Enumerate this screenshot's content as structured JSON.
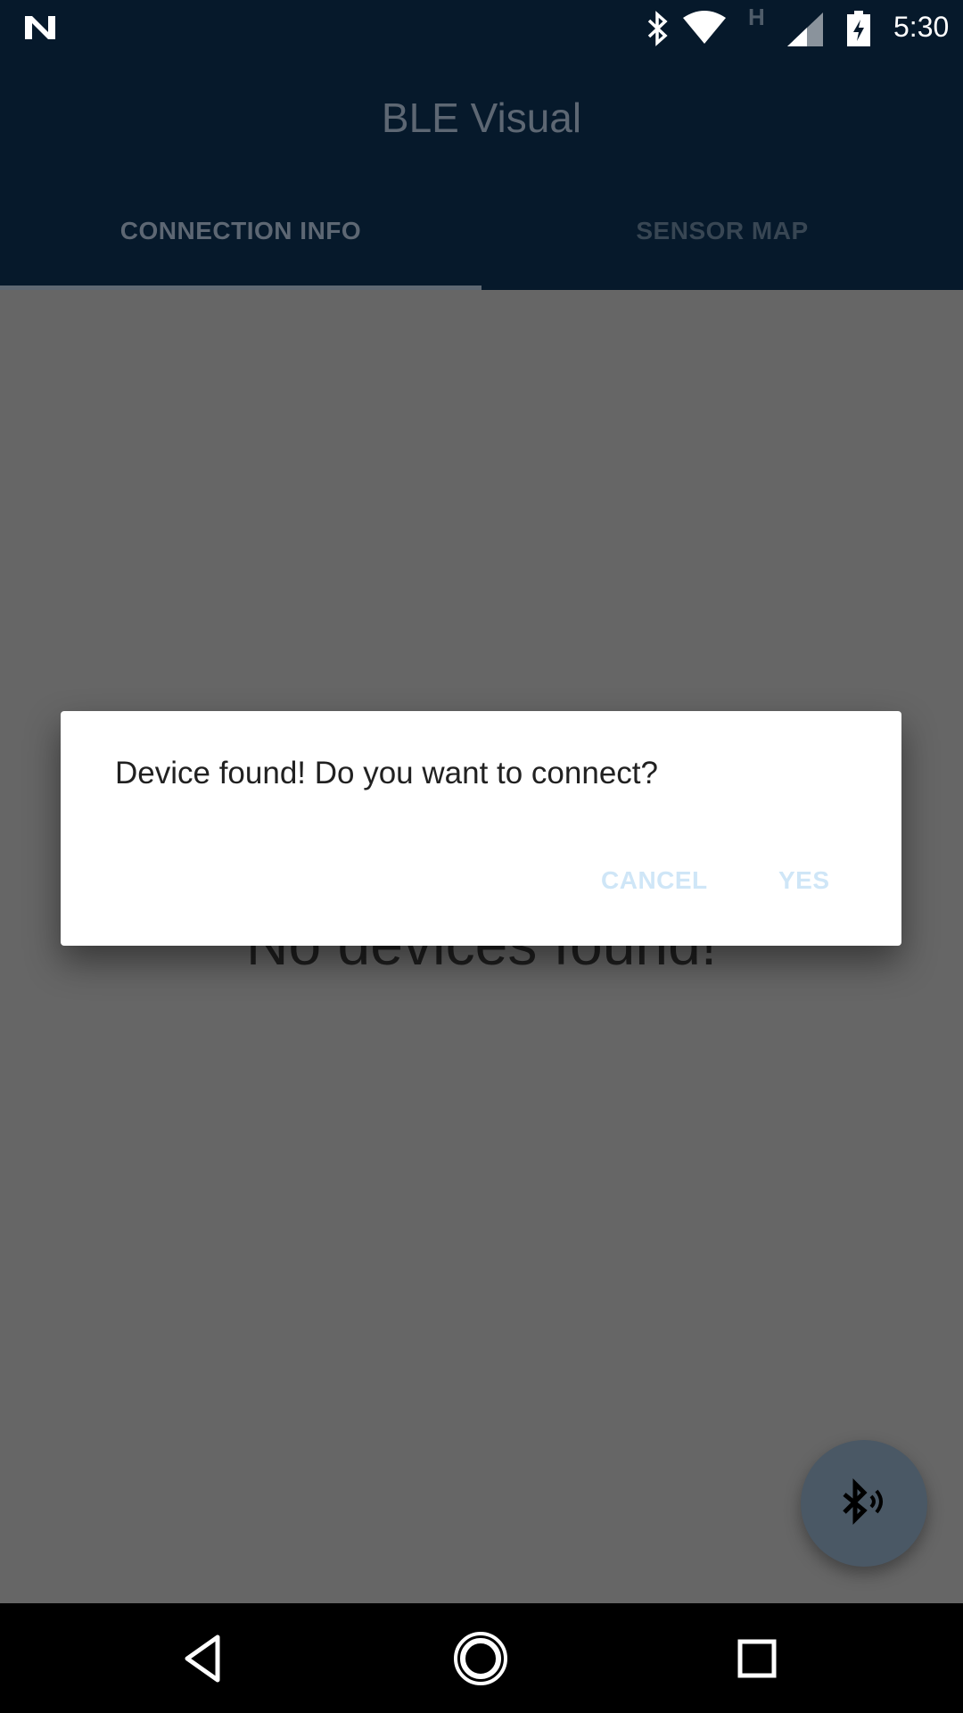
{
  "status_bar": {
    "time": "5:30",
    "network_type": "H",
    "icons": [
      "notification-n-icon",
      "bluetooth-icon",
      "wifi-icon",
      "cell-signal-icon",
      "battery-charging-icon"
    ]
  },
  "app_bar": {
    "title": "BLE Visual",
    "tabs": [
      {
        "label": "CONNECTION INFO",
        "selected": true
      },
      {
        "label": "SENSOR MAP",
        "selected": false
      }
    ]
  },
  "main": {
    "empty_message": "No devices found!"
  },
  "dialog": {
    "message": "Device found! Do you want to connect?",
    "cancel_label": "CANCEL",
    "confirm_label": "YES"
  },
  "fab": {
    "icon": "bluetooth-searching-icon"
  },
  "nav_bar": {
    "icons": [
      "back-icon",
      "home-icon",
      "recents-icon"
    ]
  },
  "colors": {
    "app_bar": "#06192b",
    "scrim_background": "#666666",
    "dialog_button_text": "#cfe6f7",
    "fab": "#4a5865"
  }
}
